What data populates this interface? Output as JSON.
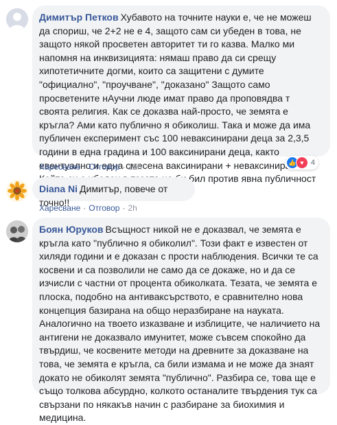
{
  "comments": [
    {
      "author": "Димитър Петков",
      "text": "Хубавото на точните науки е, че не можеш да спориш, че 2+2 не е 4, защото сам си убеден в това, не защото някой просветен авторитет ти го казва. Малко ми напомня на инквизицията: нямаш право да си срещу хипотетичните догми, които са защитени с думите \"официално\", \"проучване\", \"доказано\" Защото само просветените нАучни люде имат право да проповядва т своята религия. Как се доказва най-просто, че земята е кръгла? Ами като публично я обиколиш. Така и може да има публичен експеримент със 100 неваксинирани деца за 2,3,5 години в една градина и 100 ваксинирани деца, както евентуално и една смесена ваксинирани + неваксинирани. Който си е убеден в тезата не би бил против явна публичност в метода на доказване.",
      "like_label": "Харесване",
      "reply_label": "Отговор",
      "time": "12h",
      "reaction_count": "4",
      "reaction_icons": [
        "like-icon",
        "love-icon"
      ]
    },
    {
      "author": "Diana Ni",
      "text": "Димитър, повече от точно!!",
      "like_label": "Харесване",
      "reply_label": "Отговор",
      "time": "2h"
    },
    {
      "author": "Боян Юруков",
      "text": "Всъщност никой не е доказвал, че земята е кръгла като \"публично я обиколил\". Този факт е известен от хиляди години и е доказан с прости наблюдения. Всички те са косвени и са позволили не само да се докаже, но и да се изчисли с частни от процента обиколката. Тезата, че земята е плоска, подобно на антиваксърството, е сравнително нова концепция базирана на общо неразбиране на науката. Аналогично на твоето изказване и изблиците, че наличието на антигени не доказвало имунитет, може съвсем спокойно да твърдиш, че косвените методи на древните за доказване на това, че земята е кръгла, са били измама и не може да знаят докато не обиколят земята \"публично\". Разбира се, това ще е също толкова абсурдно, колкото останалите твърдения тук са свързани по някакъв начин с разбиране за биохимия и медицина."
    }
  ],
  "colors": {
    "bubble": "#f2f3f5",
    "author": "#385898",
    "like": "#1877f2",
    "love": "#f33e58"
  }
}
